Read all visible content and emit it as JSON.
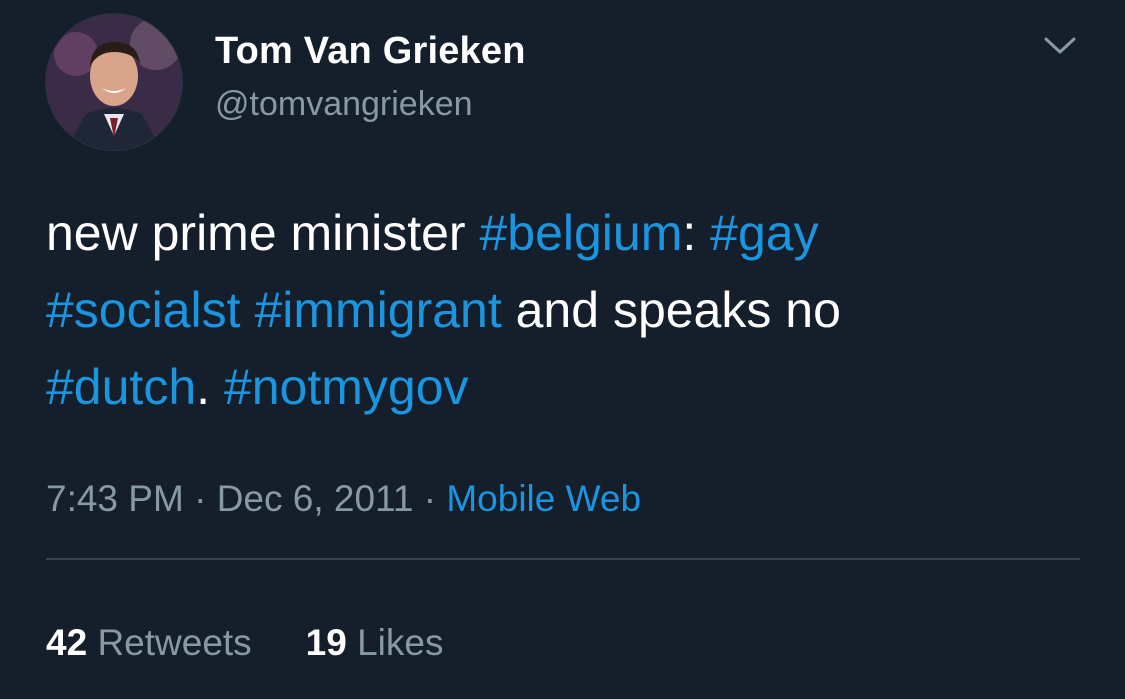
{
  "author": {
    "name": "Tom Van Grieken",
    "handle": "@tomvangrieken",
    "avatar_icon": "profile-photo"
  },
  "menu_icon": "chevron-down-icon",
  "tweet": {
    "lines": [
      [
        {
          "text": "new prime minister ",
          "hashtag": false
        },
        {
          "text": "#belgium",
          "hashtag": true
        },
        {
          "text": ": ",
          "hashtag": false
        },
        {
          "text": "#gay",
          "hashtag": true
        }
      ],
      [
        {
          "text": "#socialst",
          "hashtag": true
        },
        {
          "text": " ",
          "hashtag": false
        },
        {
          "text": "#immigrant",
          "hashtag": true
        },
        {
          "text": " and speaks no",
          "hashtag": false
        }
      ],
      [
        {
          "text": "#dutch",
          "hashtag": true
        },
        {
          "text": ". ",
          "hashtag": false
        },
        {
          "text": "#notmygov",
          "hashtag": true
        }
      ]
    ]
  },
  "meta": {
    "time": "7:43 PM",
    "separator": " · ",
    "date": "Dec 6, 2011",
    "source": "Mobile Web"
  },
  "stats": {
    "retweets_count": "42",
    "retweets_label": "Retweets",
    "likes_count": "19",
    "likes_label": "Likes"
  },
  "colors": {
    "background": "#151f2b",
    "link": "#1b95e0",
    "secondary_text": "#8899a6",
    "divider": "#38444d"
  }
}
